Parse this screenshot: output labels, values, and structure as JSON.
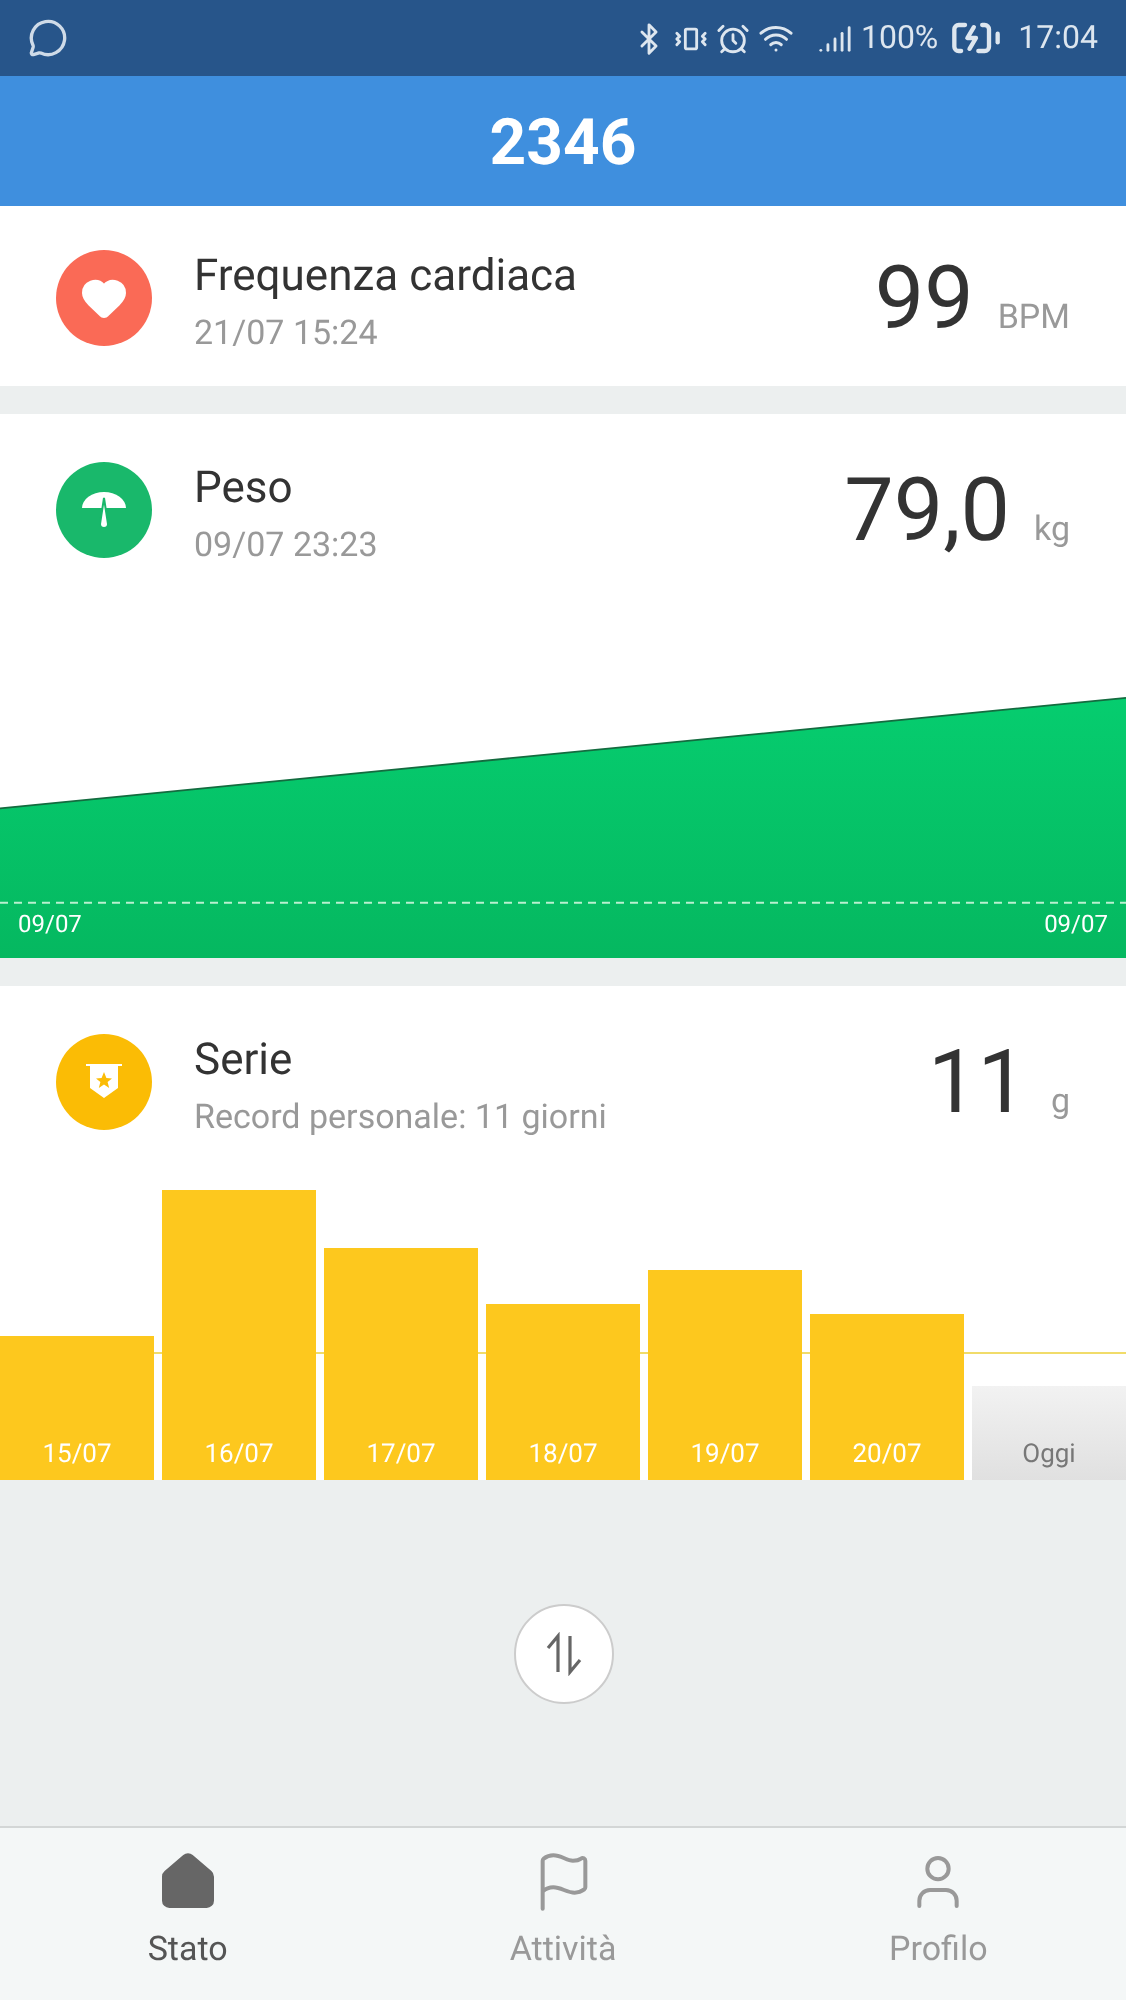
{
  "status_bar": {
    "battery": "100%",
    "time": "17:04"
  },
  "header": {
    "title": "2346"
  },
  "cards": [
    {
      "kind": "heart",
      "title": "Frequenza cardiaca",
      "subtitle": "21/07 15:24",
      "value": "99",
      "unit": "BPM"
    },
    {
      "kind": "weight",
      "title": "Peso",
      "subtitle": "09/07 23:23",
      "value": "79,0",
      "unit": "kg",
      "x_labels": [
        "09/07",
        "09/07"
      ]
    },
    {
      "kind": "streak",
      "title": "Serie",
      "subtitle": "Record personale: 11 giorni",
      "value": "11",
      "unit": "g",
      "bars": [
        {
          "label": "15/07",
          "selected": false
        },
        {
          "label": "16/07",
          "selected": false
        },
        {
          "label": "17/07",
          "selected": false
        },
        {
          "label": "18/07",
          "selected": false
        },
        {
          "label": "19/07",
          "selected": false
        },
        {
          "label": "20/07",
          "selected": false
        },
        {
          "label": "Oggi",
          "selected": true
        }
      ]
    }
  ],
  "nav": [
    {
      "label": "Stato",
      "selected": true
    },
    {
      "label": "Attività",
      "selected": false
    },
    {
      "label": "Profilo",
      "selected": false
    }
  ]
}
